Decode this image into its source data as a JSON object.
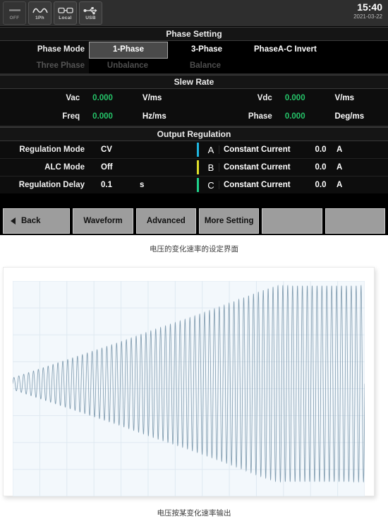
{
  "instrument": {
    "statusbar": {
      "icons": [
        {
          "name": "output-off-icon",
          "label": "OFF",
          "glyph": "—",
          "state": "off"
        },
        {
          "name": "waveform-1ph-icon",
          "label": "1Ph",
          "glyph": "sine",
          "state": "on"
        },
        {
          "name": "local-remote-icon",
          "label": "Local",
          "glyph": "link",
          "state": "on"
        },
        {
          "name": "usb-icon",
          "label": "USB",
          "glyph": "usb",
          "state": "on"
        }
      ],
      "time": "15:40",
      "date": "2021-03-22"
    },
    "phase_setting": {
      "title": "Phase Setting",
      "row1": {
        "label": "Phase Mode",
        "selected": "1-Phase",
        "options": [
          "1-Phase",
          "3-Phase",
          "PhaseA-C Invert"
        ]
      },
      "row2": {
        "label": "Three Phase",
        "options": [
          "Unbalance",
          "Balance"
        ]
      }
    },
    "slew_rate": {
      "title": "Slew Rate",
      "rows": [
        {
          "label": "Vac",
          "value": "0.000",
          "unit": "V/ms",
          "label2": "Vdc",
          "value2": "0.000",
          "unit2": "V/ms"
        },
        {
          "label": "Freq",
          "value": "0.000",
          "unit": "Hz/ms",
          "label2": "Phase",
          "value2": "0.000",
          "unit2": "Deg/ms"
        }
      ]
    },
    "output_regulation": {
      "title": "Output Regulation",
      "left_rows": [
        {
          "label": "Regulation Mode",
          "value": "CV",
          "unit": ""
        },
        {
          "label": "ALC Mode",
          "value": "Off",
          "unit": ""
        },
        {
          "label": "Regulation Delay",
          "value": "0.1",
          "unit": "s"
        }
      ],
      "phases": [
        {
          "name": "A",
          "color": "#1fb6e0",
          "mode": "Constant Current",
          "value": "0.0",
          "unit": "A"
        },
        {
          "name": "B",
          "color": "#dede2a",
          "mode": "Constant Current",
          "value": "0.0",
          "unit": "A"
        },
        {
          "name": "C",
          "color": "#1fd08a",
          "mode": "Constant Current",
          "value": "0.0",
          "unit": "A"
        }
      ]
    },
    "softkeys": [
      {
        "label": "Back",
        "icon": "triangle-left-icon"
      },
      {
        "label": "Waveform",
        "icon": ""
      },
      {
        "label": "Advanced",
        "icon": ""
      },
      {
        "label": "More Setting",
        "icon": ""
      },
      {
        "label": "",
        "icon": ""
      },
      {
        "label": "",
        "icon": ""
      }
    ]
  },
  "captions": {
    "top": "电压的变化速率的设定界面",
    "bottom": "电压按某变化速率输出"
  },
  "chart_data": {
    "type": "line",
    "title": "",
    "xlabel": "",
    "ylabel": "",
    "grid": true,
    "legend": null,
    "background": "#f3f8fc",
    "line_color": "#7794a8",
    "grid_color": "#dfe9f1",
    "description": "Sine wave whose amplitude ramps linearly upward then plateaus (voltage slew rate output)",
    "x": [
      0,
      0.1,
      0.2,
      0.3,
      0.4,
      0.5,
      0.6,
      0.7,
      0.75,
      0.8,
      0.9,
      1.0
    ],
    "envelope": [
      0.06,
      0.18,
      0.3,
      0.42,
      0.55,
      0.67,
      0.8,
      0.94,
      1.0,
      1.0,
      1.0,
      1.0
    ],
    "cycles": 72,
    "amplitude_start": 0.06,
    "amplitude_plateau": 1.0,
    "plateau_start_x": 0.72,
    "ylim": [
      -1.1,
      1.1
    ],
    "xlim": [
      0,
      1
    ]
  }
}
